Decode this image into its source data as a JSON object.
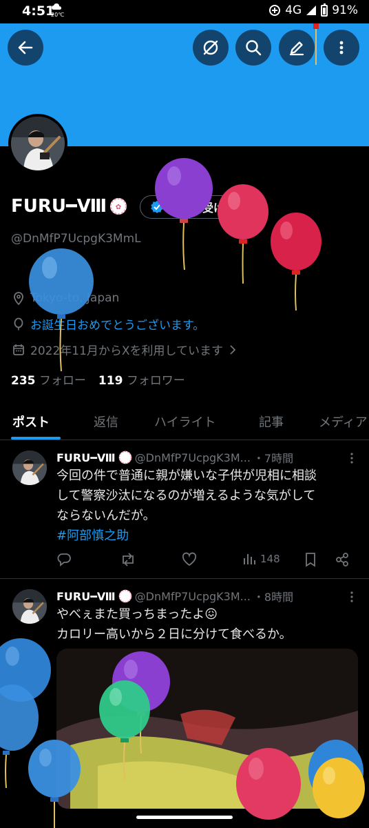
{
  "status_bar": {
    "time": "4:51",
    "temp": "20℃",
    "network": "4G",
    "battery": "91%"
  },
  "profile": {
    "display_name": "FURU━Ⅷ",
    "handle": "@DnMfP7UcpgK3MmL",
    "verify_button": "認証を受ける",
    "location": "Tokyo-to, Japan",
    "birthday": "お誕生日おめでとうございます。",
    "joined": "2022年11月からXを利用しています",
    "following_count": "235",
    "following_label": "フォロー",
    "followers_count": "119",
    "followers_label": "フォロワー"
  },
  "tabs": [
    "ポスト",
    "返信",
    "ハイライト",
    "記事",
    "メディア"
  ],
  "posts": [
    {
      "name": "FURU━Ⅷ",
      "handle": "@DnMfP7UcpgK3M...",
      "time": "・7時間",
      "lines": [
        "今回の件で普通に親が嫌いな子供が児相に相談",
        "して警察沙汰になるのが増えるような気がして",
        "ならないんだが。"
      ],
      "hashtag": "#阿部慎之助",
      "views": "148"
    },
    {
      "name": "FURU━Ⅷ",
      "handle": "@DnMfP7UcpgK3M...",
      "time": "・8時間",
      "lines": [
        "やべぇまた買っちまったよ😖",
        "カロリー高いから２日に分けて食べるか。"
      ]
    }
  ],
  "colors": {
    "accent": "#1d9bf0",
    "banner": "#1d9bf0",
    "background": "#000000"
  }
}
